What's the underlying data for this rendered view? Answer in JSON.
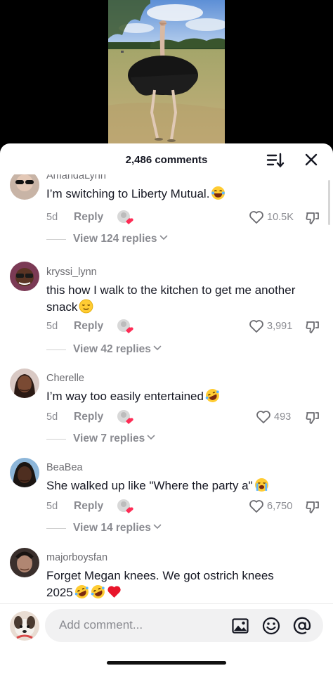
{
  "header": {
    "comment_count": "2,486 comments",
    "sort_icon": "sort-icon",
    "close_icon": "close-icon"
  },
  "comments": [
    {
      "username": "AmandaLynn",
      "text": "I’m switching to Liberty Mutual.",
      "emoji": [
        "laughing-emoji"
      ],
      "age": "5d",
      "reply_label": "Reply",
      "likes": "10.5K",
      "view_replies": "View 124 replies"
    },
    {
      "username": "kryssi_lynn",
      "text": "this how I walk to the kitchen to get me another snack",
      "emoji": [
        "relieved-emoji"
      ],
      "age": "5d",
      "reply_label": "Reply",
      "likes": "3,991",
      "view_replies": "View 42 replies"
    },
    {
      "username": "Cherelle",
      "text": "I’m way too easily entertained",
      "emoji": [
        "rofl-emoji"
      ],
      "age": "5d",
      "reply_label": "Reply",
      "likes": "493",
      "view_replies": "View 7 replies"
    },
    {
      "username": "BeaBea",
      "text": "She walked up like \"Where the party a\"",
      "emoji": [
        "crying-emoji"
      ],
      "age": "5d",
      "reply_label": "Reply",
      "likes": "6,750",
      "view_replies": "View 14 replies"
    },
    {
      "username": "majorboysfan",
      "text": "Forget Megan knees. We got ostrich knees 2025",
      "emoji": [
        "rofl-emoji",
        "rofl-emoji",
        "red-heart-emoji"
      ]
    }
  ],
  "composer": {
    "placeholder": "Add comment...",
    "icons": [
      "image-icon",
      "emoji-icon",
      "mention-icon"
    ]
  },
  "colors": {
    "like_badge": "#fe2c55",
    "text_primary": "#161823",
    "text_secondary": "#8a8b91"
  }
}
